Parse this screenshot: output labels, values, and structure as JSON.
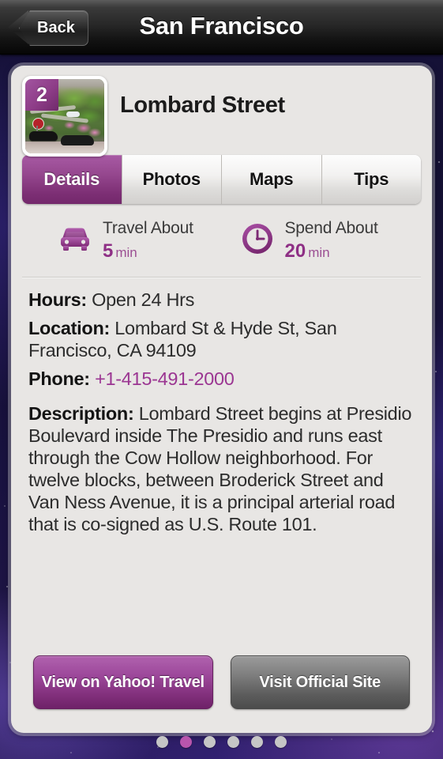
{
  "navbar": {
    "back_label": "Back",
    "title": "San Francisco"
  },
  "poi": {
    "badge_number": "2",
    "title": "Lombard Street",
    "thumbnail_alt": "lombard-street-photo"
  },
  "tabs": [
    {
      "label": "Details",
      "active": true
    },
    {
      "label": "Photos",
      "active": false
    },
    {
      "label": "Maps",
      "active": false
    },
    {
      "label": "Tips",
      "active": false
    }
  ],
  "info": {
    "travel": {
      "icon": "car-icon",
      "label": "Travel About",
      "value": "5",
      "unit": "min"
    },
    "spend": {
      "icon": "clock-icon",
      "label": "Spend About",
      "value": "20",
      "unit": "min"
    }
  },
  "details": {
    "hours_label": "Hours:",
    "hours_value": "Open 24 Hrs",
    "location_label": "Location:",
    "location_value": "Lombard St & Hyde St, San Francisco, CA 94109",
    "phone_label": "Phone:",
    "phone_value": "+1-415-491-2000",
    "description_label": "Description:",
    "description_value": "Lombard Street begins at Presidio Boulevard inside The Presidio and runs east through the Cow Hollow neighborhood. For twelve blocks, between Broderick Street and Van Ness Avenue, it is a principal arterial road that is co-signed as U.S. Route 101."
  },
  "actions": {
    "primary_label": "View on Yahoo! Travel",
    "secondary_label": "Visit Official Site"
  },
  "pager": {
    "total": 6,
    "active_index": 1
  },
  "colors": {
    "accent_purple": "#8e2f85",
    "accent_purple_light": "#b855ad",
    "card_background": "#e8e6e4",
    "navbar_dark": "#262626"
  }
}
